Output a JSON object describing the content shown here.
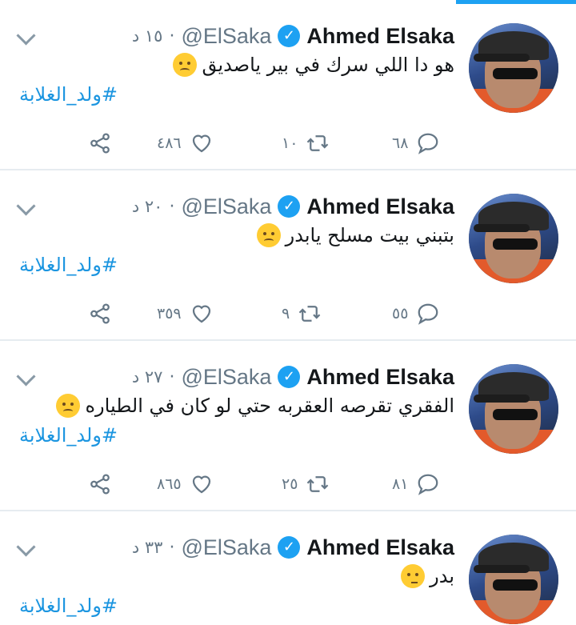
{
  "tweets": [
    {
      "name": "Ahmed Elsaka",
      "handle": "@ElSaka",
      "separator": "·",
      "time": "١٥ د",
      "text": "هو دا اللي سرك في بير ياصديق",
      "emoji": "frowning-face",
      "hashtag": "#ولد_الغلابة",
      "replies": "٦٨",
      "retweets": "١٠",
      "likes": "٤٨٦"
    },
    {
      "name": "Ahmed Elsaka",
      "handle": "@ElSaka",
      "separator": "·",
      "time": "٢٠ د",
      "text": "بتبني بيت مسلح يابدر",
      "emoji": "unamused-face",
      "hashtag": "#ولد_الغلابة",
      "replies": "٥٥",
      "retweets": "٩",
      "likes": "٣٥٩"
    },
    {
      "name": "Ahmed Elsaka",
      "handle": "@ElSaka",
      "separator": "·",
      "time": "٢٧ د",
      "text": "الفقري تقرصه العقربه حتي لو كان في الطياره",
      "emoji": "unamused-face",
      "hashtag": "#ولد_الغلابة",
      "replies": "٨١",
      "retweets": "٢٥",
      "likes": "٨٦٥"
    },
    {
      "name": "Ahmed Elsaka",
      "handle": "@ElSaka",
      "separator": "·",
      "time": "٣٣ د",
      "text": "بدر",
      "emoji": "thinking-face",
      "hashtag": "#ولد_الغلابة"
    }
  ],
  "colors": {
    "accent": "#1da1f2",
    "hashtag": "#1b95e0",
    "muted": "#657786"
  }
}
